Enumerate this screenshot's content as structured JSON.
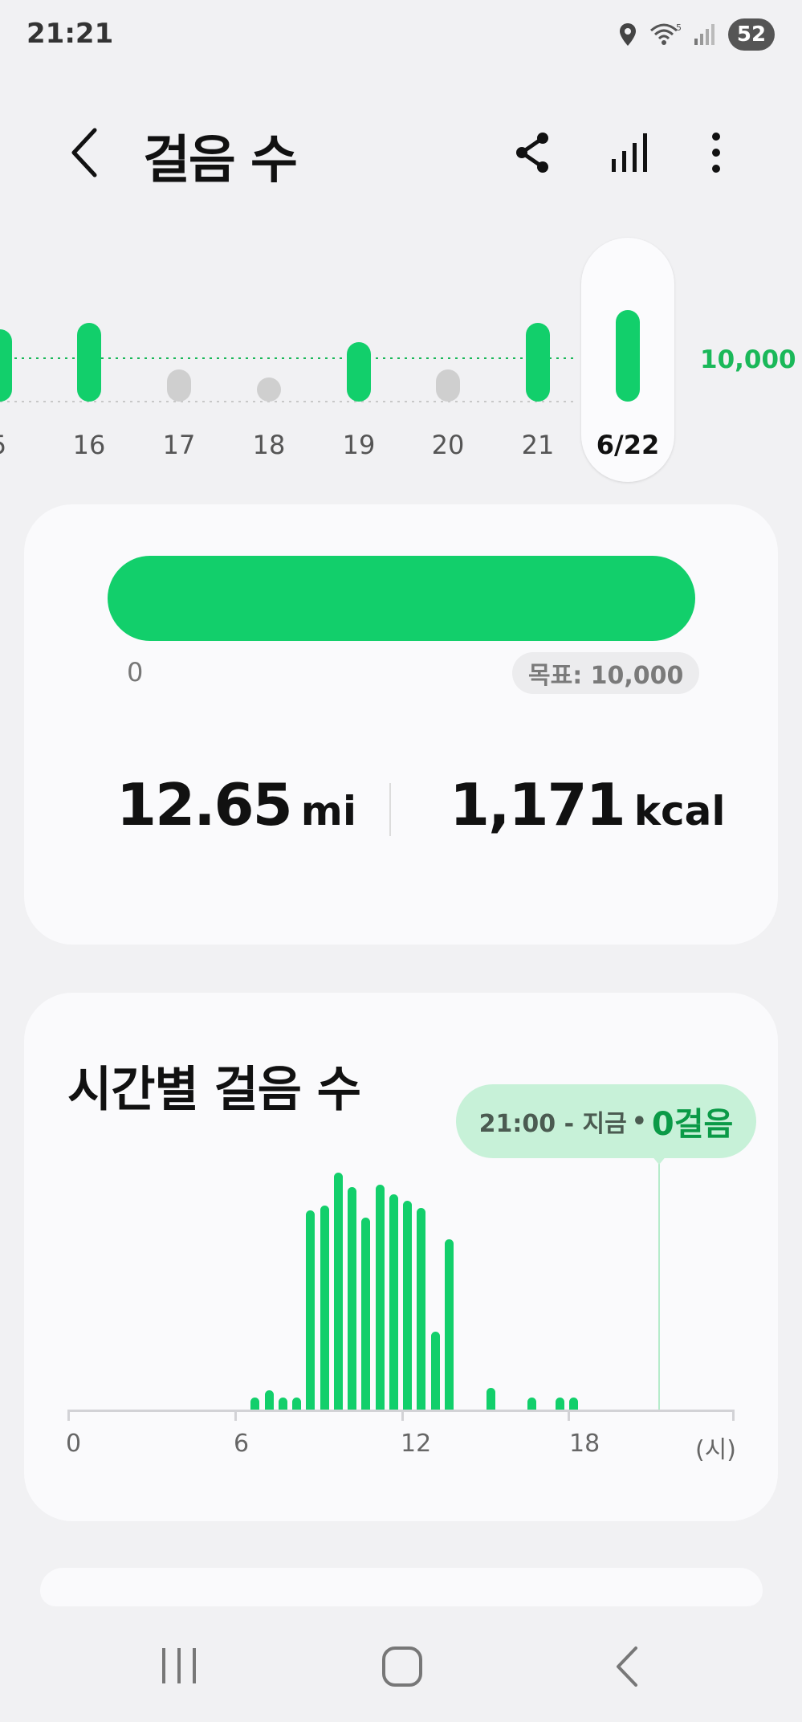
{
  "status_bar": {
    "time": "21:21",
    "battery": "52"
  },
  "header": {
    "title": "걸음 수"
  },
  "week": {
    "days": [
      {
        "label": "5",
        "steps_ratio": 1.3,
        "met_goal": true
      },
      {
        "label": "16",
        "steps_ratio": 1.45,
        "met_goal": true
      },
      {
        "label": "17",
        "steps_ratio": 0.0,
        "met_goal": false
      },
      {
        "label": "18",
        "steps_ratio": 0.0,
        "met_goal": false
      },
      {
        "label": "19",
        "steps_ratio": 1.0,
        "met_goal": true
      },
      {
        "label": "20",
        "steps_ratio": 0.0,
        "met_goal": false
      },
      {
        "label": "21",
        "steps_ratio": 1.45,
        "met_goal": true
      },
      {
        "label": "6/22",
        "steps_ratio": 1.75,
        "met_goal": true,
        "selected": true
      }
    ],
    "goal_label": "10,000"
  },
  "summary": {
    "progress_fraction": 1.0,
    "progress_min": "0",
    "goal_chip": "목표: 10,000",
    "distance_value": "12.65",
    "distance_unit": "mi",
    "calories_value": "1,171",
    "calories_unit": "kcal"
  },
  "hourly": {
    "title": "시간별 걸음 수",
    "bubble_range": "21:00 - 지금",
    "bubble_sep": "•",
    "bubble_value": "0걸음",
    "axis_labels": [
      "0",
      "6",
      "12",
      "18",
      "(시)"
    ],
    "bars": [
      {
        "hour": 6.5,
        "rel": 0.05
      },
      {
        "hour": 7.0,
        "rel": 0.08
      },
      {
        "hour": 7.5,
        "rel": 0.05
      },
      {
        "hour": 8.0,
        "rel": 0.05
      },
      {
        "hour": 8.5,
        "rel": 0.84
      },
      {
        "hour": 9.0,
        "rel": 0.86
      },
      {
        "hour": 9.5,
        "rel": 1.0
      },
      {
        "hour": 10.0,
        "rel": 0.94
      },
      {
        "hour": 10.5,
        "rel": 0.81
      },
      {
        "hour": 11.0,
        "rel": 0.95
      },
      {
        "hour": 11.5,
        "rel": 0.91
      },
      {
        "hour": 12.0,
        "rel": 0.88
      },
      {
        "hour": 12.5,
        "rel": 0.85
      },
      {
        "hour": 13.0,
        "rel": 0.33
      },
      {
        "hour": 13.5,
        "rel": 0.72
      },
      {
        "hour": 15.0,
        "rel": 0.09
      },
      {
        "hour": 16.5,
        "rel": 0.05
      },
      {
        "hour": 17.5,
        "rel": 0.05
      },
      {
        "hour": 18.0,
        "rel": 0.05
      }
    ]
  },
  "colors": {
    "accent": "#12cf6b",
    "goal_text": "#1ab859",
    "inactive_bar": "#cfcfcf"
  }
}
